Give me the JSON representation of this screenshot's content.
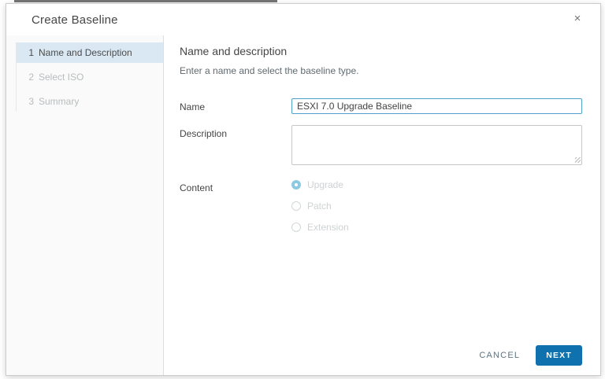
{
  "dialog": {
    "title": "Create Baseline",
    "close_icon": "×"
  },
  "steps": [
    {
      "number": "1",
      "label": "Name and Description",
      "active": true
    },
    {
      "number": "2",
      "label": "Select ISO",
      "active": false
    },
    {
      "number": "3",
      "label": "Summary",
      "active": false
    }
  ],
  "content": {
    "heading": "Name and description",
    "subheading": "Enter a name and select the baseline type.",
    "form": {
      "name_label": "Name",
      "name_value": "ESXI 7.0 Upgrade Baseline",
      "description_label": "Description",
      "description_value": "",
      "content_label": "Content",
      "options": [
        {
          "label": "Upgrade",
          "selected": true,
          "disabled": true
        },
        {
          "label": "Patch",
          "selected": false,
          "disabled": true
        },
        {
          "label": "Extension",
          "selected": false,
          "disabled": true
        }
      ]
    }
  },
  "footer": {
    "cancel_label": "CANCEL",
    "next_label": "NEXT"
  },
  "colors": {
    "primary_blue": "#0f72ae",
    "focus_border_blue": "#4fa1ce",
    "active_step_bg": "#d9e8f2",
    "selected_radio_blue": "#8ec9e2"
  }
}
